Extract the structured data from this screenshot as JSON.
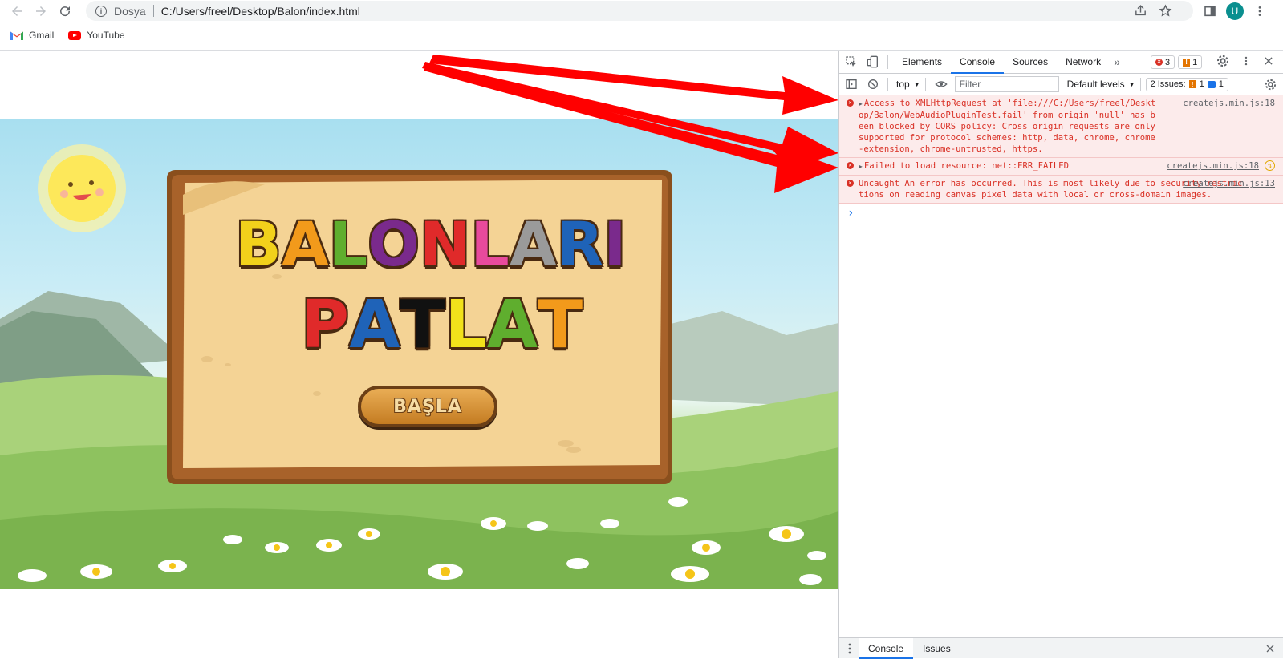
{
  "browser": {
    "scheme_label": "Dosya",
    "url": "C:/Users/freel/Desktop/Balon/index.html",
    "profile_initial": "U",
    "bookmarks": [
      {
        "label": "Gmail",
        "icon": "gmail-icon"
      },
      {
        "label": "YouTube",
        "icon": "youtube-icon"
      }
    ]
  },
  "game": {
    "title_line1": [
      "B",
      "A",
      "L",
      "O",
      "N",
      "L",
      "A",
      "R",
      "I"
    ],
    "title_line1_colors": [
      "#f2d11b",
      "#f29a1b",
      "#5fae2e",
      "#7a2a8c",
      "#e02a2a",
      "#e84a9c",
      "#9a9a9a",
      "#1f63b8",
      "#7a2a8c"
    ],
    "title_line2": [
      "P",
      "A",
      "T",
      "L",
      "A",
      "T"
    ],
    "title_line2_colors": [
      "#e02a2a",
      "#1f63b8",
      "#111111",
      "#f2e21b",
      "#5fae2e",
      "#f29a1b"
    ],
    "start_button": "BAŞLA"
  },
  "devtools": {
    "tabs": [
      "Elements",
      "Console",
      "Sources",
      "Network"
    ],
    "active_tab": "Console",
    "error_count": "3",
    "warning_count": "1",
    "context": "top",
    "filter_placeholder": "Filter",
    "levels": "Default levels",
    "issues_label": "2 Issues:",
    "issues_warn": "1",
    "issues_info": "1",
    "messages": [
      {
        "prefix": "Access to XMLHttpRequest at '",
        "link": "file:///C:/Users/freel/Desktop/Balon/WebAudioPluginTest.fail",
        "suffix": "' from origin 'null' has been blocked by CORS policy: Cross origin requests are only supported for protocol schemes: http, data, chrome, chrome-extension, chrome-untrusted, https.",
        "source": "createjs.min.js:18"
      },
      {
        "text": "Failed to load resource: net::ERR_FAILED",
        "source": "createjs.min.js:18"
      },
      {
        "text": "Uncaught An error has occurred. This is most likely due to security restrictions on reading canvas pixel data with local or cross-domain images.",
        "source": "createjs.min.js:13"
      }
    ],
    "drawer_tabs": [
      "Console",
      "Issues"
    ]
  },
  "colors": {
    "accent": "#1a73e8",
    "error": "#d93025",
    "error_bg": "#fcebeb",
    "annotation_arrows": "#ff0000"
  }
}
